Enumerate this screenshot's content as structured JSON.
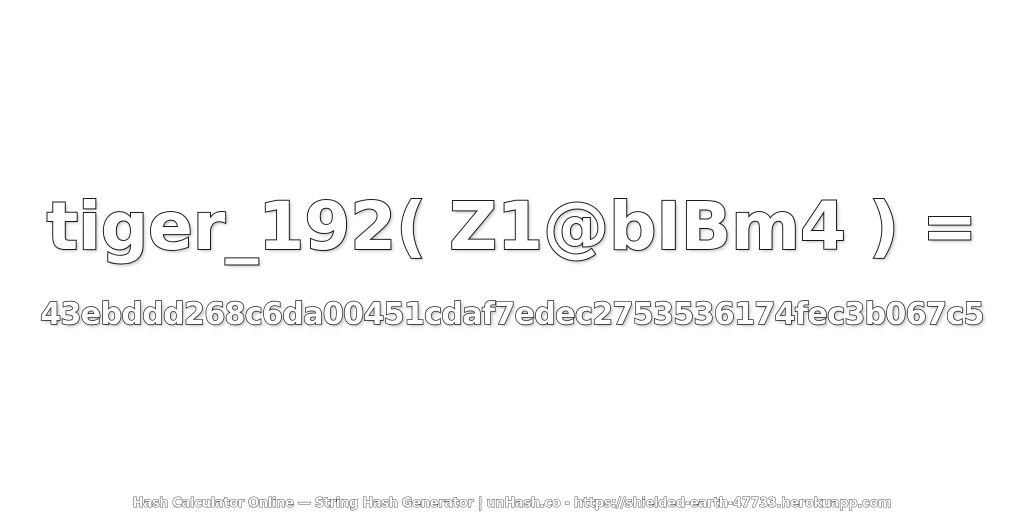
{
  "title": "tiger_192( Z1@bIBm4 ) =",
  "hash": "43ebddd268c6da00451cdaf7edec2753536174fec3b067c5",
  "footer": "Hash Calculator Online — String Hash Generator | unHash.co - https://shielded-earth-47733.herokuapp.com"
}
